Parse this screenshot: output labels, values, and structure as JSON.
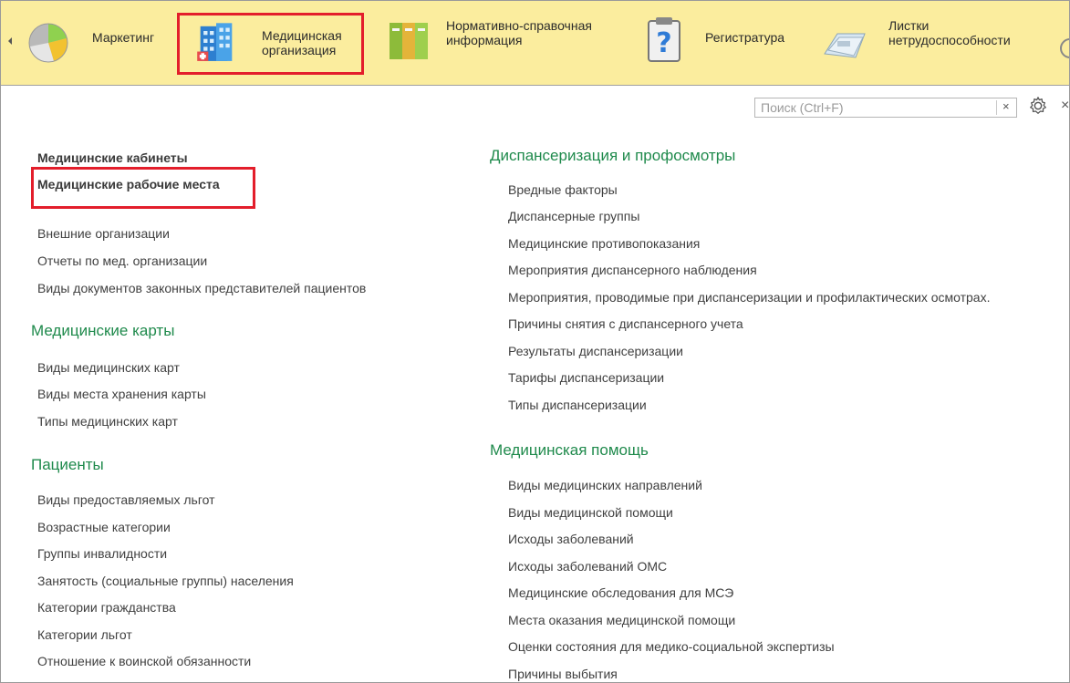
{
  "sections": [
    {
      "name": "marketing",
      "label": "Маркетинг"
    },
    {
      "name": "med-org",
      "label": "Медицинская организация",
      "selected": true
    },
    {
      "name": "nsi",
      "label": "Нормативно-справочная информация"
    },
    {
      "name": "registry",
      "label": "Регистратура"
    },
    {
      "name": "sick-leave",
      "label": "Листки нетрудоспособности"
    }
  ],
  "search": {
    "placeholder": "Поиск (Ctrl+F)",
    "clear": "×"
  },
  "left": {
    "top_items": [
      "Медицинские кабинеты",
      "Медицинские рабочие места"
    ],
    "items": [
      "Внешние организации",
      "Отчеты по мед. организации",
      "Виды документов законных представителей пациентов"
    ],
    "groups": [
      {
        "title": "Медицинские карты",
        "items": [
          "Виды медицинских карт",
          "Виды места хранения карты",
          "Типы медицинских карт"
        ]
      },
      {
        "title": "Пациенты",
        "items": [
          "Виды предоставляемых льгот",
          "Возрастные категории",
          "Группы инвалидности",
          "Занятость (социальные группы) населения",
          "Категории гражданства",
          "Категории льгот",
          "Отношение к воинской обязанности"
        ]
      }
    ]
  },
  "right": {
    "groups": [
      {
        "title": "Диспансеризация и профосмотры",
        "items": [
          "Вредные факторы",
          "Диспансерные группы",
          "Медицинские противопоказания",
          "Мероприятия диспансерного наблюдения",
          "Мероприятия, проводимые при диспансеризации и профилактических осмотрах.",
          "Причины снятия с диспансерного учета",
          "Результаты диспансеризации",
          "Тарифы диспансеризации",
          "Типы диспансеризации"
        ]
      },
      {
        "title": "Медицинская помощь",
        "items": [
          "Виды медицинских направлений",
          "Виды медицинской помощи",
          "Исходы заболеваний",
          "Исходы заболеваний ОМС",
          "Медицинские обследования для МСЭ",
          "Места оказания медицинской помощи",
          "Оценки состояния для медико-социальной экспертизы",
          "Причины выбытия"
        ]
      }
    ]
  },
  "colors": {
    "topbar": "#fbed9e",
    "highlight": "#e31e2b",
    "group_title": "#1f8a4c"
  }
}
